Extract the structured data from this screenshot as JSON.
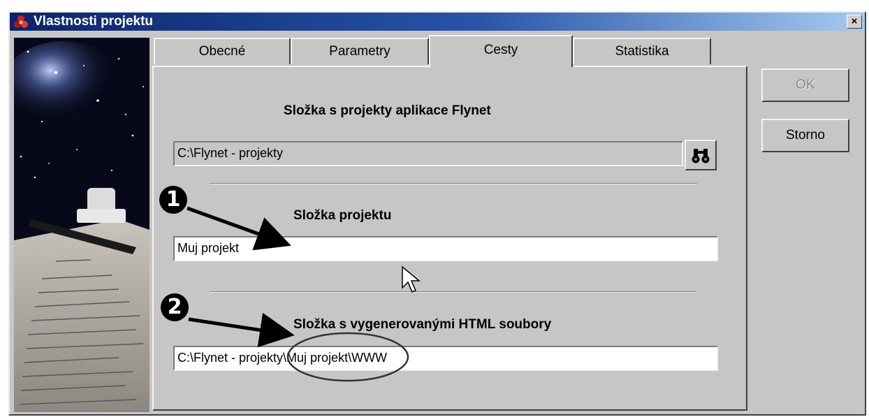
{
  "window": {
    "title": "Vlastnosti projektu",
    "close_label": "×"
  },
  "tabs": [
    {
      "label": "Obecné",
      "active": false
    },
    {
      "label": "Parametry",
      "active": false
    },
    {
      "label": "Cesty",
      "active": true
    },
    {
      "label": "Statistika",
      "active": false
    }
  ],
  "paths": {
    "flynet_projects_label": "Složka s projekty aplikace Flynet",
    "flynet_projects_value": "C:\\Flynet - projekty",
    "project_folder_label": "Složka projektu",
    "project_folder_value": "Muj projekt",
    "html_output_label": "Složka s vygenerovanými HTML soubory",
    "html_output_value": "C:\\Flynet - projekty\\Muj projekt\\WWW"
  },
  "buttons": {
    "ok_label": "OK",
    "cancel_label": "Storno"
  },
  "annotations": {
    "marker_1": "1",
    "marker_2": "2"
  },
  "icons": {
    "app": "flynet-logo-icon",
    "browse": "binoculars-icon",
    "cursor": "mouse-pointer-icon"
  },
  "colors": {
    "titlebar_start": "#0a246a",
    "titlebar_end": "#a6caf0",
    "dialog_face": "#c6c6c6"
  }
}
